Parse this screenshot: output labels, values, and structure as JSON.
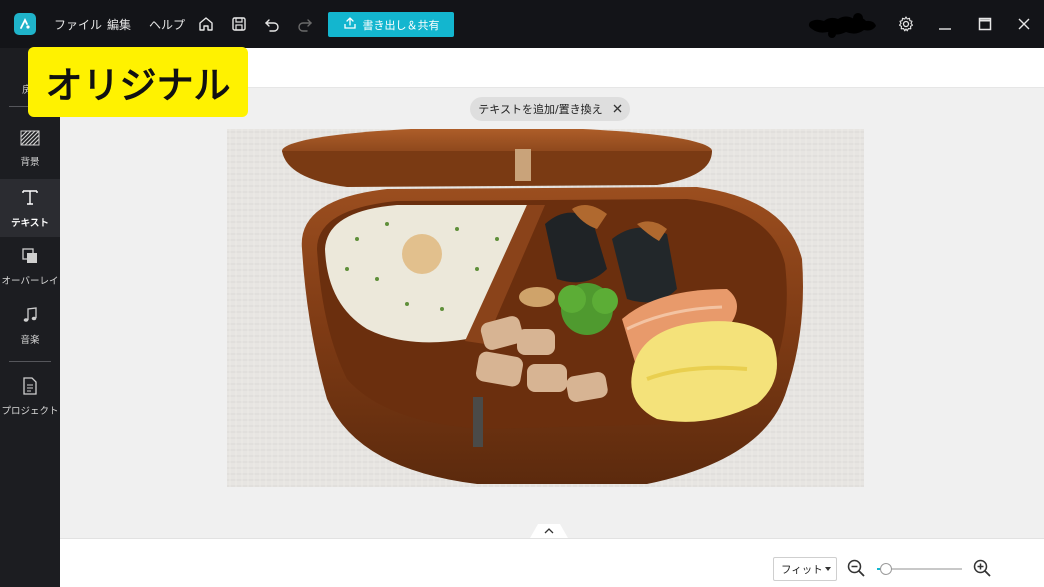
{
  "titlebar": {
    "menu": [
      "ファイル",
      "編集",
      "ヘルプ"
    ],
    "export_label": "書き出し＆共有",
    "accent_color": "#13b6cf"
  },
  "sidebar": {
    "items": [
      {
        "label": "背景",
        "icon": "background-hatch-icon"
      },
      {
        "label": "テキスト",
        "icon": "text-T-icon",
        "active": true
      },
      {
        "label": "オーバーレイ",
        "icon": "overlay-icon"
      },
      {
        "label": "音楽",
        "icon": "music-note-icon"
      },
      {
        "label": "プロジェクト",
        "icon": "document-icon"
      }
    ],
    "partial_label": "房"
  },
  "canvas": {
    "pill_text": "テキストを追加/置き換え",
    "photo_subject": "bento box"
  },
  "bottombar": {
    "fit_label": "フィット",
    "zoom_level": 0.1
  },
  "badge": {
    "text": "オリジナル",
    "color": "#fff200"
  }
}
